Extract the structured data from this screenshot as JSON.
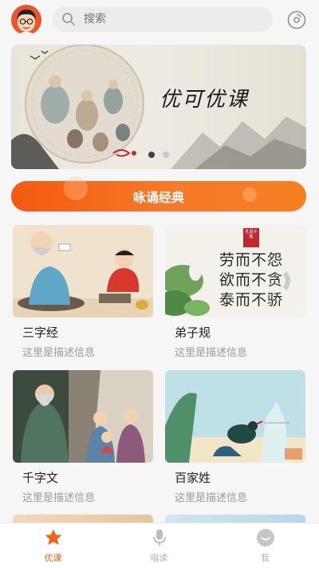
{
  "search": {
    "placeholder": "搜索"
  },
  "banner": {
    "title": "优可优课",
    "active_index": 0,
    "total": 2
  },
  "featured": {
    "label": "咏诵经典"
  },
  "courses": [
    {
      "name": "三字经",
      "desc": "这里是描述信息"
    },
    {
      "name": "弟子规",
      "desc": "这里是描述信息"
    },
    {
      "name": "千字文",
      "desc": "这里是描述信息"
    },
    {
      "name": "百家姓",
      "desc": "这里是描述信息"
    }
  ],
  "dizigui_calligraphy": {
    "seal": "孔说子集",
    "lines": [
      "劳而不怨",
      "欲而不贪",
      "泰而不骄"
    ]
  },
  "tabs": [
    {
      "label": "优课",
      "active": true
    },
    {
      "label": "唱读",
      "active": false
    },
    {
      "label": "我",
      "active": false
    }
  ],
  "colors": {
    "accent": "#f5621a",
    "inactive": "#b5b5b5"
  }
}
